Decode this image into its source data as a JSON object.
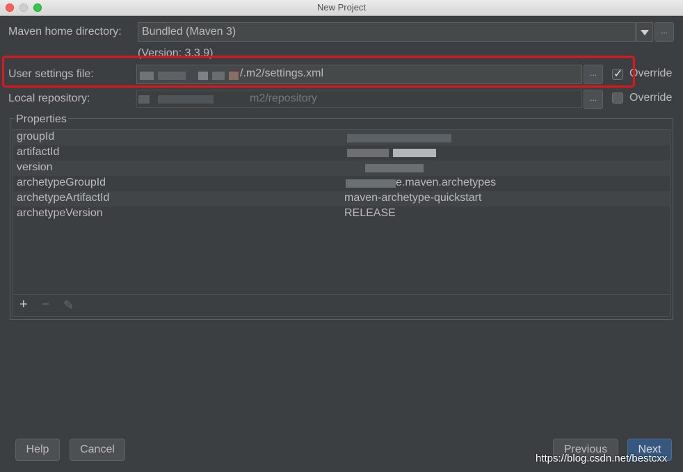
{
  "window": {
    "title": "New Project"
  },
  "maven_home": {
    "label": "Maven home directory:",
    "value": "Bundled (Maven 3)",
    "version": "(Version: 3.3.9)"
  },
  "user_settings": {
    "label": "User settings file:",
    "value_suffix": "/.m2/settings.xml",
    "override_label": "Override",
    "override_checked": true
  },
  "local_repo": {
    "label": "Local repository:",
    "value_suffix": "m2/repository",
    "override_label": "Override",
    "override_checked": false
  },
  "browse_label": "...",
  "properties": {
    "title": "Properties",
    "rows": [
      {
        "key": "groupId",
        "value": ""
      },
      {
        "key": "artifactId",
        "value": ""
      },
      {
        "key": "version",
        "value": ""
      },
      {
        "key": "archetypeGroupId",
        "value": "e.maven.archetypes"
      },
      {
        "key": "archetypeArtifactId",
        "value": "maven-archetype-quickstart"
      },
      {
        "key": "archetypeVersion",
        "value": "RELEASE"
      }
    ],
    "toolbar": {
      "add": "+",
      "remove": "−",
      "edit": "✎"
    }
  },
  "buttons": {
    "help": "Help",
    "cancel": "Cancel",
    "previous": "Previous",
    "next": "Next"
  },
  "watermark": "https://blog.csdn.net/bestcxx",
  "colors": {
    "highlight": "#e3151b",
    "primary_button": "#365880",
    "background": "#3c3f41"
  }
}
